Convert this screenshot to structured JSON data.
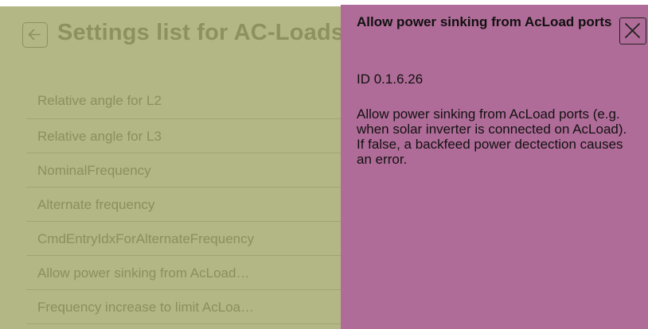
{
  "settings": {
    "title": "Settings list for AC-Loads",
    "items": [
      {
        "label": "Relative angle for L2"
      },
      {
        "label": "Relative angle for L3"
      },
      {
        "label": "NominalFrequency"
      },
      {
        "label": "Alternate frequency"
      },
      {
        "label": "CmdEntryIdxForAlternateFrequency"
      },
      {
        "label": "Allow power sinking from AcLoad…"
      },
      {
        "label": "Frequency increase to limit AcLoa…"
      }
    ]
  },
  "help": {
    "title": "Allow power sinking from AcLoad ports",
    "id": "ID 0.1.6.26",
    "description": "Allow power sinking from AcLoad ports (e.g. when solar inverter is connected on AcLoad). If false, a backfeed power dectection causes an error."
  },
  "icons": {
    "back": "arrow-left-icon",
    "close": "close-x-icon"
  },
  "colors": {
    "settings_background": "#b3b785",
    "settings_text": "#8d915f",
    "help_panel_background": "#b06c98"
  }
}
